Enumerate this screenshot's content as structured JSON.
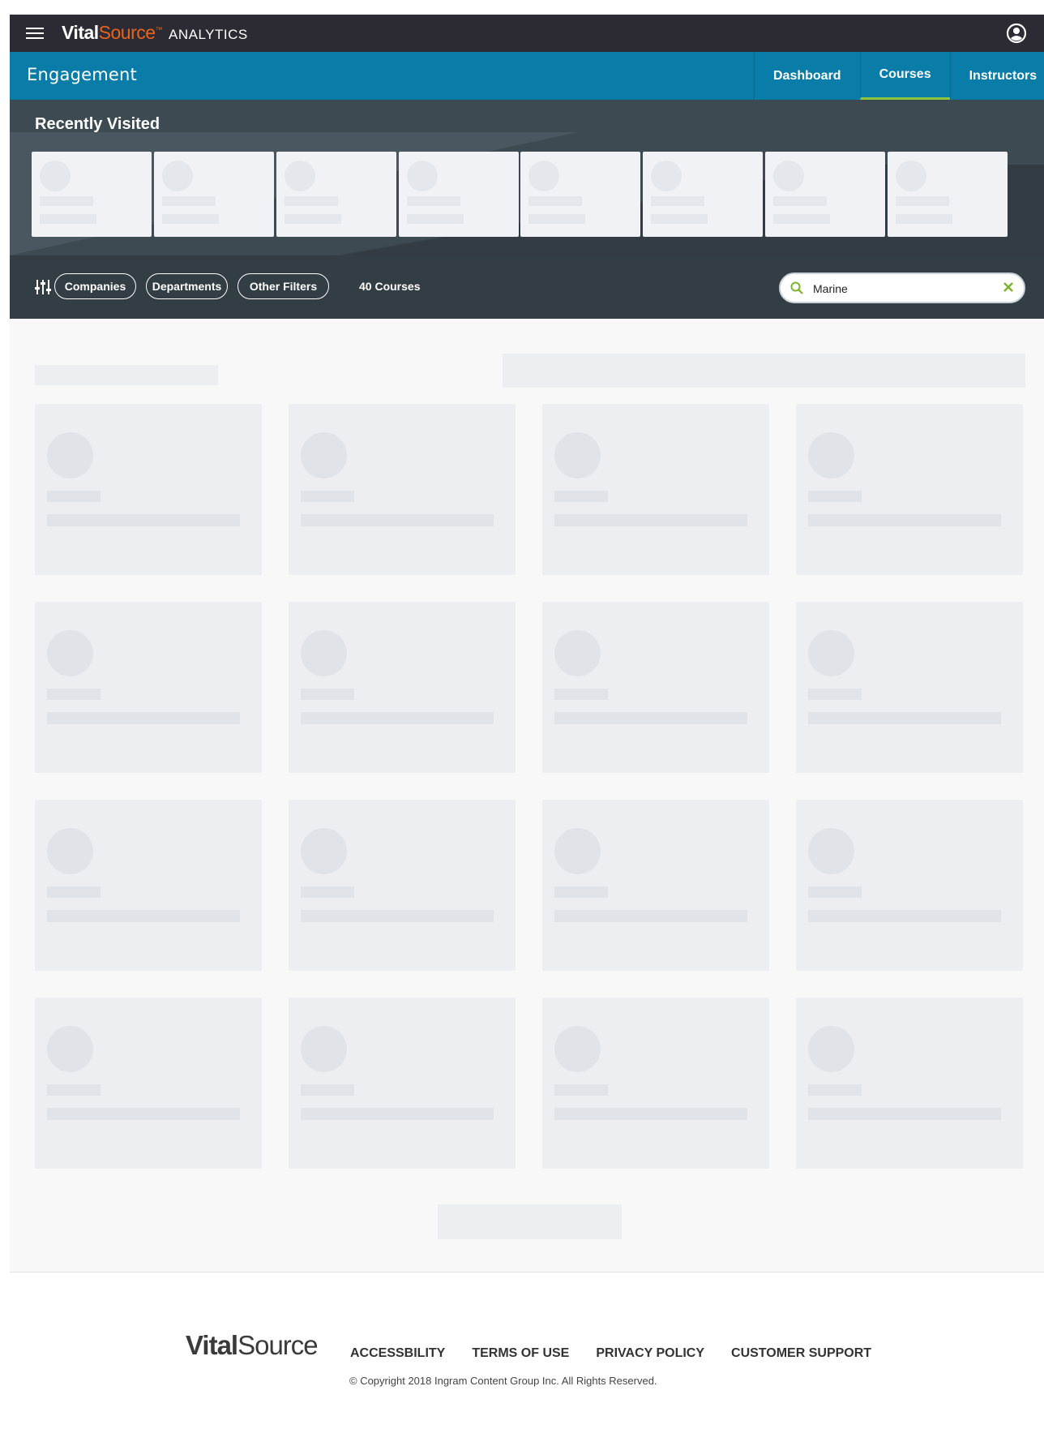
{
  "app": {
    "brand_vital": "Vital",
    "brand_source": "Source",
    "brand_tm": "™",
    "brand_product": "ANALYTICS"
  },
  "header": {
    "section_title": "Engagement",
    "tabs": [
      {
        "label": "Dashboard",
        "active": false
      },
      {
        "label": "Courses",
        "active": true
      },
      {
        "label": "Instructors",
        "active": false
      }
    ]
  },
  "recent": {
    "title": "Recently Visited"
  },
  "filters": {
    "pills": [
      "Companies",
      "Departments",
      "Other Filters"
    ],
    "count_label": "40 Courses"
  },
  "search": {
    "value": "Marine"
  },
  "footer": {
    "logo_vital": "Vital",
    "logo_source": "Source",
    "links": [
      "ACCESSBILITY",
      "TERMS OF USE",
      "PRIVACY POLICY",
      "CUSTOMER SUPPORT"
    ],
    "copyright": "© Copyright 2018 Ingram Content Group Inc. All Rights Reserved."
  },
  "colors": {
    "topbar": "#2c2b33",
    "section_bar": "#0a7ca8",
    "accent_green": "#8cc63f",
    "brand_orange": "#e8641b",
    "filter_bar": "#323d44"
  },
  "icons": [
    "hamburger-icon",
    "user-account-icon",
    "filter-sliders-icon",
    "search-icon",
    "close-icon"
  ]
}
